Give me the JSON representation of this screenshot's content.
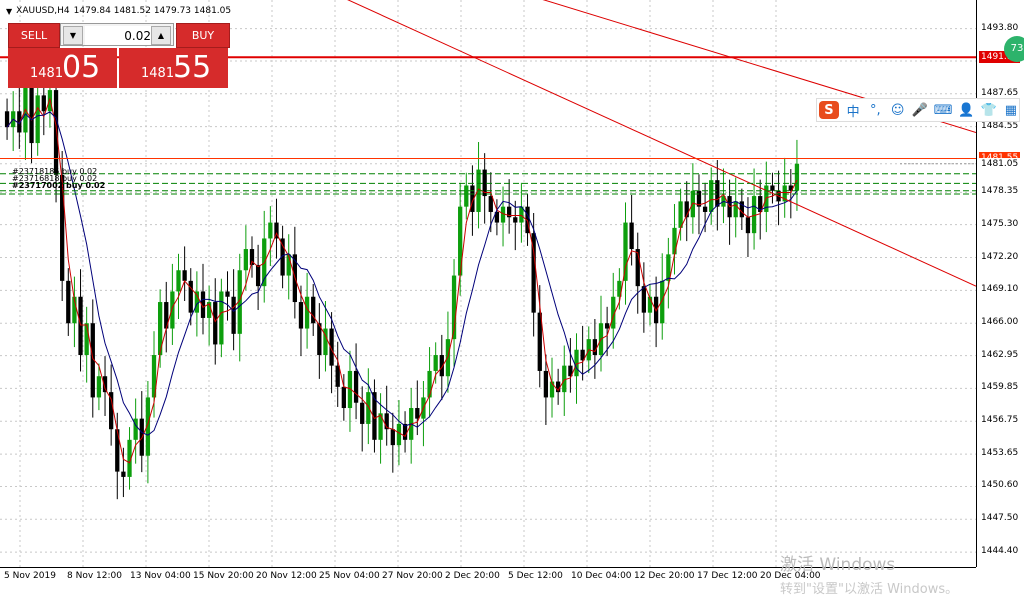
{
  "window": {
    "symbol": "XAUUSD,H4",
    "ohlc": "1479.84 1481.52 1479.73 1481.05"
  },
  "trade_panel": {
    "sell_label": "SELL",
    "buy_label": "BUY",
    "lot_value": "0.02",
    "bid_prefix": "1481",
    "bid_big": "05",
    "ask_prefix": "1481",
    "ask_big": "55"
  },
  "orders": [
    {
      "label": "#23718185 buy 0.02"
    },
    {
      "label": "#23716818 buy 0.02"
    },
    {
      "label": "#23717002 buy 0.02"
    }
  ],
  "price_axis": {
    "labels": [
      "1493.80",
      "1490.75",
      "1487.65",
      "1484.55",
      "1481.05",
      "1478.35",
      "1475.30",
      "1472.20",
      "1469.10",
      "1466.00",
      "1462.95",
      "1459.85",
      "1456.75",
      "1453.65",
      "1450.60",
      "1447.50",
      "1444.40"
    ],
    "tag_line": "1491.10",
    "tag_ask": "1481.55",
    "tag_bid": "1481.05"
  },
  "time_axis": {
    "labels": [
      "5 Nov 2019",
      "8 Nov 12:00",
      "13 Nov 04:00",
      "15 Nov 20:00",
      "20 Nov 12:00",
      "25 Nov 04:00",
      "27 Nov 20:00",
      "2 Dec 20:00",
      "5 Dec 12:00",
      "10 Dec 04:00",
      "12 Dec 20:00",
      "17 Dec 12:00",
      "20 Dec 04:00"
    ]
  },
  "ime": {
    "logo": "S",
    "mode": "中",
    "punct": "°,",
    "emoji": "☺",
    "mic": "🎤",
    "keyboard": "⌨",
    "user": "👤",
    "shirt": "👕",
    "grid": "▦"
  },
  "badge": "73",
  "watermark": {
    "line1": "激活 Windows",
    "line2": "转到\"设置\"以激活 Windows。"
  },
  "colors": {
    "bull": "#0d9e0d",
    "bear": "#000000",
    "ma_fast": "#cc0000",
    "ma_slow": "#00007a",
    "trendline": "#dd0000",
    "order_line": "#008000",
    "ask_line": "#ff3300",
    "panel_red": "#d62b2b"
  },
  "chart_data": {
    "type": "candlestick",
    "symbol": "XAUUSD",
    "timeframe": "H4",
    "ylim": [
      1443.0,
      1496.5
    ],
    "current_bid": 1481.05,
    "current_ask": 1481.55,
    "horizontal_line": 1491.1,
    "order_levels": [
      1480.1,
      1479.2,
      1478.5,
      1478.2
    ],
    "trendlines": [
      {
        "from": [
          0.345,
          1497.0
        ],
        "to": [
          1.0,
          1469.5
        ]
      },
      {
        "from": [
          0.54,
          1497.0
        ],
        "to": [
          1.0,
          1484.0
        ]
      }
    ],
    "closes": [
      1484.5,
      1486.0,
      1484.0,
      1488.5,
      1483.0,
      1487.5,
      1486.0,
      1488.0,
      1480.0,
      1470.0,
      1466.0,
      1468.5,
      1463.0,
      1466.0,
      1459.0,
      1461.0,
      1459.5,
      1456.0,
      1452.0,
      1451.5,
      1455.0,
      1457.0,
      1453.5,
      1459.0,
      1463.0,
      1468.0,
      1465.5,
      1469.0,
      1471.0,
      1470.0,
      1467.0,
      1469.0,
      1466.5,
      1468.0,
      1464.0,
      1469.0,
      1468.5,
      1465.0,
      1471.0,
      1473.0,
      1471.5,
      1469.5,
      1474.0,
      1475.5,
      1474.0,
      1470.5,
      1472.5,
      1468.0,
      1465.5,
      1468.5,
      1466.0,
      1463.0,
      1465.5,
      1462.0,
      1460.0,
      1458.0,
      1461.5,
      1458.5,
      1456.5,
      1459.5,
      1455.0,
      1457.5,
      1456.0,
      1454.5,
      1456.5,
      1455.0,
      1458.0,
      1457.0,
      1459.0,
      1461.5,
      1463.0,
      1461.0,
      1464.5,
      1470.5,
      1477.0,
      1479.0,
      1476.5,
      1480.5,
      1478.0,
      1476.5,
      1475.5,
      1477.0,
      1476.0,
      1475.5,
      1477.0,
      1474.5,
      1467.0,
      1461.5,
      1459.0,
      1460.5,
      1459.5,
      1462.0,
      1461.0,
      1463.5,
      1462.5,
      1464.5,
      1463.0,
      1466.0,
      1465.5,
      1468.5,
      1470.0,
      1475.5,
      1473.0,
      1469.5,
      1467.0,
      1468.5,
      1466.0,
      1470.0,
      1472.5,
      1475.0,
      1477.5,
      1476.0,
      1478.5,
      1477.0,
      1476.5,
      1479.5,
      1477.0,
      1478.0,
      1476.0,
      1477.5,
      1476.0,
      1474.5,
      1478.0,
      1476.5,
      1479.0,
      1478.5,
      1477.5,
      1479.0,
      1478.5,
      1481.05
    ]
  }
}
